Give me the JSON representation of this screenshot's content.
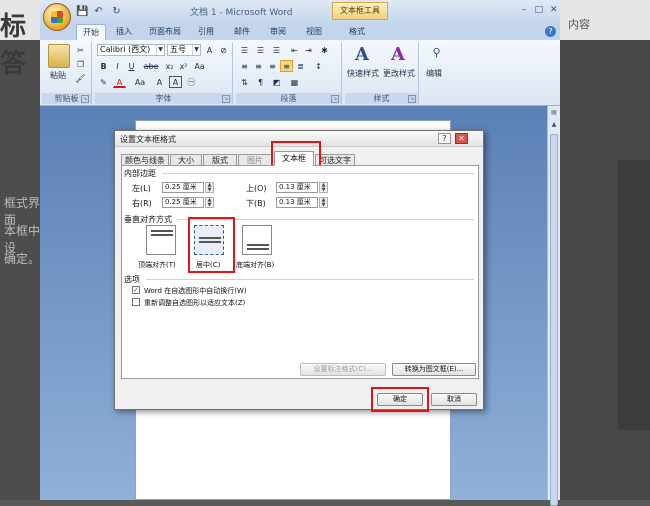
{
  "background": {
    "left_heading": "标答",
    "left_lines": [
      "框式界面",
      "本框中设",
      "确定。"
    ],
    "right_text": "内容"
  },
  "word": {
    "title": "文档 1 - Microsoft Word",
    "context_tool": "文本框工具",
    "qat": {
      "save_icon": "💾",
      "undo_icon": "↶",
      "redo_icon": "↻"
    },
    "window_buttons": {
      "minimize": "–",
      "maximize": "□",
      "close": "✕"
    },
    "help_icon": "?",
    "tabs": [
      "开始",
      "插入",
      "页面布局",
      "引用",
      "邮件",
      "审阅",
      "视图",
      "格式"
    ],
    "active_tab": "开始"
  },
  "ribbon": {
    "clipboard": {
      "paste_label": "粘贴",
      "group": "剪贴板"
    },
    "font": {
      "font_name": "Calibri (西文)",
      "font_size": "五号",
      "bold": "B",
      "italic": "I",
      "underline": "U",
      "strikethrough": "abe",
      "subscript": "x₂",
      "superscript": "x²",
      "text_color": "A",
      "highlight": "Aa",
      "font_color": "A",
      "char_border": "A",
      "group": "字体"
    },
    "paragraph": {
      "group": "段落"
    },
    "styles": {
      "quick_styles": "快速样式",
      "change_styles": "更改样式",
      "group": "样式"
    },
    "editing": {
      "label": "编辑"
    }
  },
  "dialog": {
    "title": "设置文本框格式",
    "help": "?",
    "close": "✕",
    "tabs": [
      "颜色与线条",
      "大小",
      "版式",
      "图片",
      "文本框",
      "可选文字"
    ],
    "active_tab": "文本框",
    "inner_margin": {
      "section": "内部边距",
      "left_label": "左(L)",
      "left_value": "0.25 厘米",
      "right_label": "右(R)",
      "right_value": "0.25 厘米",
      "top_label": "上(O)",
      "top_value": "0.13 厘米",
      "bottom_label": "下(B)",
      "bottom_value": "0.13 厘米"
    },
    "vertical_alignment": {
      "section": "垂直对齐方式",
      "options": [
        "顶端对齐(T)",
        "居中(C)",
        "底端对齐(B)"
      ],
      "selected": "居中(C)"
    },
    "options": {
      "section": "选项",
      "wrap_text": "Word 在自选图形中自动换行(W)",
      "wrap_checked": "✓",
      "resize_shape": "重新调整自选图形以适应文本(Z)"
    },
    "buttons": {
      "callout_format": "设置标注格式(C)...",
      "convert_frame": "转换为图文框(E)...",
      "ok": "确定",
      "cancel": "取消"
    }
  },
  "colors": {
    "highlight_red": "#e0141e",
    "ribbon_blue": "#c3d5ec"
  }
}
